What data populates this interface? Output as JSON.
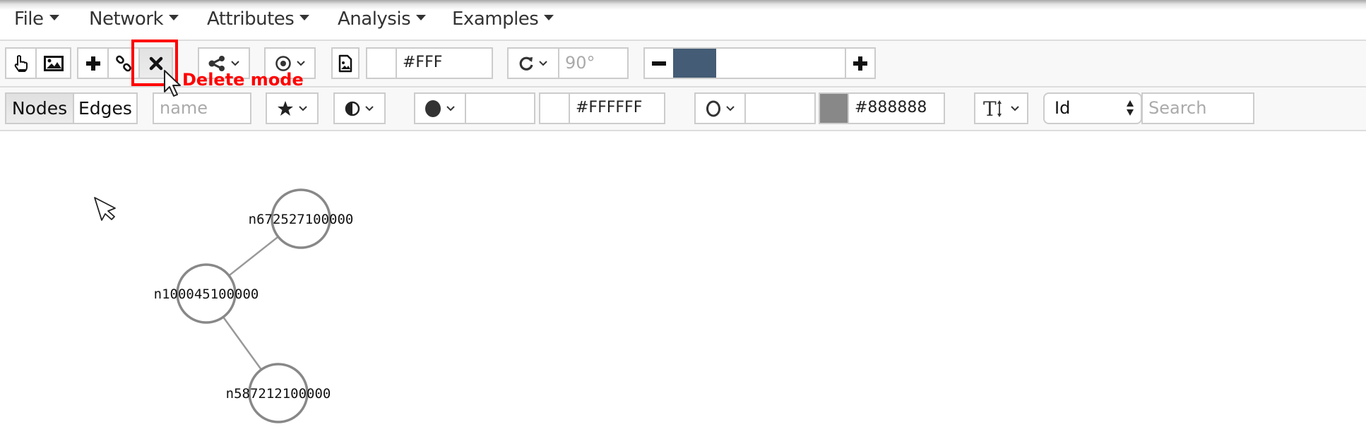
{
  "menubar": {
    "items": [
      {
        "label": "File"
      },
      {
        "label": "Network"
      },
      {
        "label": "Attributes"
      },
      {
        "label": "Analysis"
      },
      {
        "label": "Examples"
      }
    ]
  },
  "toolbar1": {
    "mode_buttons": [
      {
        "name": "pointer-mode",
        "icon": "hand-pointer-icon",
        "active": false
      },
      {
        "name": "image-mode",
        "icon": "image-icon",
        "active": false
      },
      {
        "name": "add-node-mode",
        "icon": "plus-icon",
        "active": false
      },
      {
        "name": "add-edge-mode",
        "icon": "link-icon",
        "active": false
      },
      {
        "name": "delete-mode",
        "icon": "close-x-icon",
        "active": true
      }
    ],
    "layout_dropdown_icon": "share-nodes-icon",
    "center_dropdown_icon": "target-icon",
    "background_image_icon": "file-image-icon",
    "background_color_value": "#FFF",
    "background_color": "#FFFFFF",
    "rotate_icon": "rotate-cw-icon",
    "rotation_placeholder": "90°",
    "zoom": {
      "minus_icon": "minus-icon",
      "plus_icon": "plus-icon",
      "level_fraction": 0.25,
      "fill_color": "#445C75"
    }
  },
  "annotation": {
    "label": "Delete mode",
    "color": "#FF0000"
  },
  "toolbar2": {
    "segment": [
      {
        "label": "Nodes",
        "active": true
      },
      {
        "label": "Edges",
        "active": false
      }
    ],
    "name_placeholder": "name",
    "shape_icon": "star-icon",
    "opacity_icon": "half-circle-icon",
    "fill_shape_icon": "filled-circle-icon",
    "fill_size_value": "",
    "fill_color_value": "#FFFFFF",
    "fill_color": "#FFFFFF",
    "border_shape_icon": "empty-circle-icon",
    "border_size_value": "",
    "border_color_value": "#888888",
    "border_color": "#888888",
    "text_size_icon": "text-height-icon",
    "label_select": {
      "selected": "Id"
    },
    "search_placeholder": "Search"
  },
  "graph": {
    "nodes": [
      {
        "id": "n672527100000",
        "label": "n672527100000"
      },
      {
        "id": "n100045100000",
        "label": "n100045100000"
      },
      {
        "id": "n587212100000",
        "label": "n587212100000"
      }
    ],
    "edges": [
      {
        "source": "n100045100000",
        "target": "n672527100000"
      },
      {
        "source": "n100045100000",
        "target": "n587212100000"
      }
    ],
    "node_border_color": "#888888",
    "edge_color": "#999999"
  }
}
